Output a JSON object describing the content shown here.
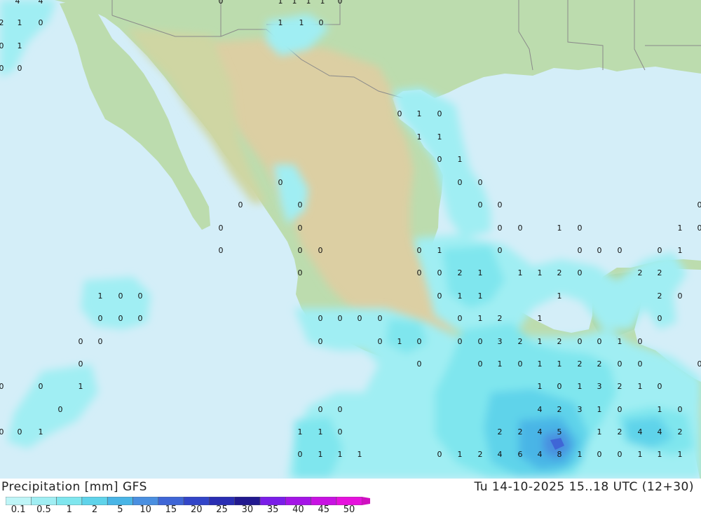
{
  "title": {
    "left": "Precipitation [mm] GFS",
    "right": "Tu 14-10-2025 15..18 UTC (12+30)"
  },
  "legend": {
    "colors": [
      "#bff5f7",
      "#a0eef3",
      "#7fe6ee",
      "#5fd3ea",
      "#49b5e6",
      "#4a8fe0",
      "#3f66d6",
      "#3245c8",
      "#2a2eb3",
      "#22198f",
      "#7a1ee8",
      "#a415e6",
      "#c812e2",
      "#e611dd",
      "#d010c0"
    ],
    "labels": [
      "0.1",
      "0.5",
      "1",
      "2",
      "5",
      "10",
      "15",
      "20",
      "25",
      "30",
      "35",
      "40",
      "45",
      "50"
    ]
  },
  "map": {
    "colors": {
      "ocean": "#d4eef8",
      "land_low": "#b9dcae",
      "land_mid": "#cfd9a8",
      "plateau": "#dcd0a6",
      "border": "#8a8a8a"
    },
    "values": [
      [
        "4",
        25,
        2
      ],
      [
        "4",
        58,
        2
      ],
      [
        "0",
        315,
        2
      ],
      [
        "1",
        400,
        2
      ],
      [
        "1",
        420,
        2
      ],
      [
        "1",
        440,
        2
      ],
      [
        "1",
        460,
        2
      ],
      [
        "0",
        485,
        2
      ],
      [
        "2",
        2,
        33
      ],
      [
        "1",
        28,
        33
      ],
      [
        "0",
        58,
        33
      ],
      [
        "1",
        400,
        33
      ],
      [
        "1",
        430,
        33
      ],
      [
        "0",
        458,
        33
      ],
      [
        "0",
        2,
        66
      ],
      [
        "1",
        28,
        66
      ],
      [
        "0",
        2,
        98
      ],
      [
        "0",
        28,
        98
      ],
      [
        "0",
        570,
        163
      ],
      [
        "1",
        598,
        163
      ],
      [
        "0",
        627,
        163
      ],
      [
        "1",
        598,
        196
      ],
      [
        "1",
        627,
        196
      ],
      [
        "0",
        627,
        228
      ],
      [
        "1",
        656,
        228
      ],
      [
        "0",
        400,
        261
      ],
      [
        "0",
        656,
        261
      ],
      [
        "0",
        685,
        261
      ],
      [
        "0",
        343,
        293
      ],
      [
        "0",
        428,
        293
      ],
      [
        "0",
        685,
        293
      ],
      [
        "0",
        713,
        293
      ],
      [
        "0",
        998,
        293
      ],
      [
        "0",
        315,
        326
      ],
      [
        "0",
        428,
        326
      ],
      [
        "0",
        713,
        326
      ],
      [
        "0",
        742,
        326
      ],
      [
        "1",
        798,
        326
      ],
      [
        "0",
        827,
        326
      ],
      [
        "1",
        970,
        326
      ],
      [
        "0",
        998,
        326
      ],
      [
        "0",
        315,
        358
      ],
      [
        "0",
        428,
        358
      ],
      [
        "0",
        457,
        358
      ],
      [
        "0",
        598,
        358
      ],
      [
        "1",
        627,
        358
      ],
      [
        "0",
        713,
        358
      ],
      [
        "0",
        827,
        358
      ],
      [
        "0",
        855,
        358
      ],
      [
        "0",
        884,
        358
      ],
      [
        "0",
        941,
        358
      ],
      [
        "1",
        970,
        358
      ],
      [
        "0",
        428,
        390
      ],
      [
        "0",
        598,
        390
      ],
      [
        "0",
        627,
        390
      ],
      [
        "2",
        656,
        390
      ],
      [
        "1",
        685,
        390
      ],
      [
        "1",
        742,
        390
      ],
      [
        "1",
        770,
        390
      ],
      [
        "2",
        798,
        390
      ],
      [
        "0",
        827,
        390
      ],
      [
        "2",
        913,
        390
      ],
      [
        "2",
        941,
        390
      ],
      [
        "1",
        143,
        423
      ],
      [
        "0",
        172,
        423
      ],
      [
        "0",
        200,
        423
      ],
      [
        "0",
        627,
        423
      ],
      [
        "1",
        656,
        423
      ],
      [
        "1",
        685,
        423
      ],
      [
        "1",
        798,
        423
      ],
      [
        "2",
        941,
        423
      ],
      [
        "0",
        970,
        423
      ],
      [
        "0",
        143,
        455
      ],
      [
        "0",
        172,
        455
      ],
      [
        "0",
        200,
        455
      ],
      [
        "0",
        457,
        455
      ],
      [
        "0",
        485,
        455
      ],
      [
        "0",
        513,
        455
      ],
      [
        "0",
        542,
        455
      ],
      [
        "0",
        656,
        455
      ],
      [
        "1",
        685,
        455
      ],
      [
        "2",
        713,
        455
      ],
      [
        "1",
        770,
        455
      ],
      [
        "0",
        941,
        455
      ],
      [
        "0",
        115,
        488
      ],
      [
        "0",
        143,
        488
      ],
      [
        "0",
        457,
        488
      ],
      [
        "0",
        542,
        488
      ],
      [
        "1",
        570,
        488
      ],
      [
        "0",
        598,
        488
      ],
      [
        "0",
        656,
        488
      ],
      [
        "0",
        685,
        488
      ],
      [
        "3",
        713,
        488
      ],
      [
        "2",
        742,
        488
      ],
      [
        "1",
        770,
        488
      ],
      [
        "2",
        798,
        488
      ],
      [
        "0",
        827,
        488
      ],
      [
        "0",
        855,
        488
      ],
      [
        "1",
        884,
        488
      ],
      [
        "0",
        913,
        488
      ],
      [
        "0",
        115,
        520
      ],
      [
        "0",
        598,
        520
      ],
      [
        "0",
        685,
        520
      ],
      [
        "1",
        713,
        520
      ],
      [
        "0",
        742,
        520
      ],
      [
        "1",
        770,
        520
      ],
      [
        "1",
        798,
        520
      ],
      [
        "2",
        827,
        520
      ],
      [
        "2",
        855,
        520
      ],
      [
        "0",
        884,
        520
      ],
      [
        "0",
        913,
        520
      ],
      [
        "0",
        998,
        520
      ],
      [
        "0",
        2,
        552
      ],
      [
        "0",
        58,
        552
      ],
      [
        "1",
        115,
        552
      ],
      [
        "1",
        770,
        552
      ],
      [
        "0",
        798,
        552
      ],
      [
        "1",
        827,
        552
      ],
      [
        "3",
        855,
        552
      ],
      [
        "2",
        884,
        552
      ],
      [
        "1",
        913,
        552
      ],
      [
        "0",
        941,
        552
      ],
      [
        "0",
        86,
        585
      ],
      [
        "0",
        457,
        585
      ],
      [
        "0",
        485,
        585
      ],
      [
        "4",
        770,
        585
      ],
      [
        "2",
        798,
        585
      ],
      [
        "3",
        827,
        585
      ],
      [
        "1",
        855,
        585
      ],
      [
        "0",
        884,
        585
      ],
      [
        "1",
        941,
        585
      ],
      [
        "0",
        970,
        585
      ],
      [
        "0",
        2,
        617
      ],
      [
        "0",
        28,
        617
      ],
      [
        "1",
        58,
        617
      ],
      [
        "1",
        428,
        617
      ],
      [
        "1",
        457,
        617
      ],
      [
        "0",
        485,
        617
      ],
      [
        "2",
        713,
        617
      ],
      [
        "2",
        742,
        617
      ],
      [
        "4",
        770,
        617
      ],
      [
        "5",
        798,
        617
      ],
      [
        "1",
        855,
        617
      ],
      [
        "2",
        884,
        617
      ],
      [
        "4",
        913,
        617
      ],
      [
        "4",
        941,
        617
      ],
      [
        "2",
        970,
        617
      ],
      [
        "0",
        428,
        649
      ],
      [
        "1",
        457,
        649
      ],
      [
        "1",
        485,
        649
      ],
      [
        "1",
        513,
        649
      ],
      [
        "0",
        627,
        649
      ],
      [
        "1",
        656,
        649
      ],
      [
        "2",
        685,
        649
      ],
      [
        "4",
        713,
        649
      ],
      [
        "6",
        742,
        649
      ],
      [
        "4",
        770,
        649
      ],
      [
        "8",
        798,
        649
      ],
      [
        "1",
        827,
        649
      ],
      [
        "0",
        855,
        649
      ],
      [
        "0",
        884,
        649
      ],
      [
        "1",
        913,
        649
      ],
      [
        "1",
        941,
        649
      ],
      [
        "1",
        970,
        649
      ]
    ]
  }
}
